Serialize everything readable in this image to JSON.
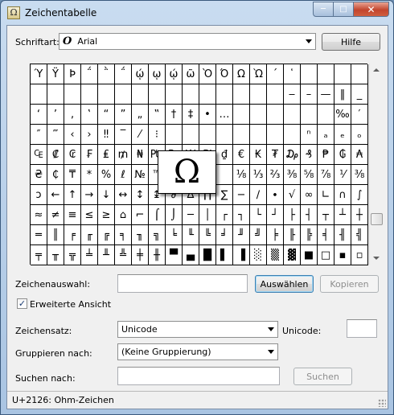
{
  "window": {
    "title": "Zeichentabelle",
    "controls": {
      "minimize": "─",
      "maximize": "□",
      "close": "✕"
    }
  },
  "font_row": {
    "label": "Schriftart:",
    "font_icon_glyph": "O",
    "selected_font": "Arial",
    "help_button": "Hilfe"
  },
  "grid": {
    "cells": [
      [
        "Ύ",
        "Ϋ",
        "Ϸ",
        "΅",
        "῭",
        "΅",
        "ῴ",
        "ῳ",
        "ῴ",
        "ῶ",
        "Ὸ",
        "Ό",
        "Ω",
        "Ὼ",
        "´",
        "῾",
        "",
        "",
        "",
        ""
      ],
      [
        "",
        "",
        "",
        "",
        "",
        "",
        "",
        "",
        "",
        "",
        "",
        "",
        "",
        "",
        "",
        "‒",
        "–",
        "—",
        "‖",
        "_"
      ],
      [
        "‘",
        "’",
        "‚",
        "‛",
        "“",
        "”",
        "„",
        "‟",
        "†",
        "‡",
        "•",
        "…",
        "",
        "",
        "",
        "",
        "",
        "",
        "‰",
        "′"
      ],
      [
        "″",
        "‴",
        "‹",
        "›",
        "‼",
        "‾",
        "⁄",
        "⁝",
        "",
        "",
        "",
        "",
        "",
        "",
        "",
        "",
        "ⁿ",
        "ₐ",
        "ₑ",
        "ₒ"
      ],
      [
        "₠",
        "₡",
        "₢",
        "₣",
        "₤",
        "₥",
        "₦",
        "₧",
        "₨",
        "₩",
        "₪",
        "₫",
        "€",
        "₭",
        "₮",
        "₯",
        "₰",
        "₱",
        "₲",
        "₳"
      ],
      [
        "₴",
        "₵",
        "₸",
        "*",
        "%",
        "ℓ",
        "№",
        "™",
        "",
        "",
        "",
        "",
        "⅛",
        "⅓",
        "⅔",
        "⅜",
        "⅝",
        "⅞",
        "⅟",
        "⅜"
      ],
      [
        "ↄ",
        "←",
        "↑",
        "→",
        "↓",
        "↔",
        "↕",
        "↨",
        "∂",
        "∆",
        "∏",
        "∑",
        "−",
        "∕",
        "∙",
        "√",
        "∞",
        "∟",
        "∩",
        "∫"
      ],
      [
        "≈",
        "≠",
        "≡",
        "≤",
        "≥",
        "⌂",
        "⌐",
        "⌠",
        "⌡",
        "─",
        "│",
        "┌",
        "┐",
        "└",
        "┘",
        "├",
        "┤",
        "┬",
        "┴",
        "┼"
      ],
      [
        "═",
        "║",
        "╒",
        "╓",
        "╔",
        "╕",
        "╖",
        "╗",
        "╘",
        "╙",
        "╚",
        "╛",
        "╜",
        "╝",
        "╞",
        "╟",
        "╠",
        "╡",
        "╢",
        "╣"
      ],
      [
        "╤",
        "╥",
        "╦",
        "╧",
        "╨",
        "╩",
        "╪",
        "╫",
        "▀",
        "▄",
        "█",
        "▌",
        "▐",
        "░",
        "▒",
        "▓",
        "■",
        "□",
        "▪",
        "▫"
      ]
    ],
    "magnified_char": "Ω"
  },
  "selection_row": {
    "label": "Zeichenauswahl:",
    "value": "",
    "select_button": "Auswählen",
    "copy_button": "Kopieren"
  },
  "advanced_view": {
    "label": "Erweiterte Ansicht",
    "checked": true,
    "checkmark": "✓"
  },
  "charset_row": {
    "label": "Zeichensatz:",
    "selected": "Unicode",
    "unicode_label": "Unicode:",
    "unicode_value": ""
  },
  "group_row": {
    "label": "Gruppieren nach:",
    "selected": "(Keine Gruppierung)"
  },
  "search_row": {
    "label": "Suchen nach:",
    "value": "",
    "search_button": "Suchen"
  },
  "status": {
    "text": "U+2126: Ohm-Zeichen"
  }
}
